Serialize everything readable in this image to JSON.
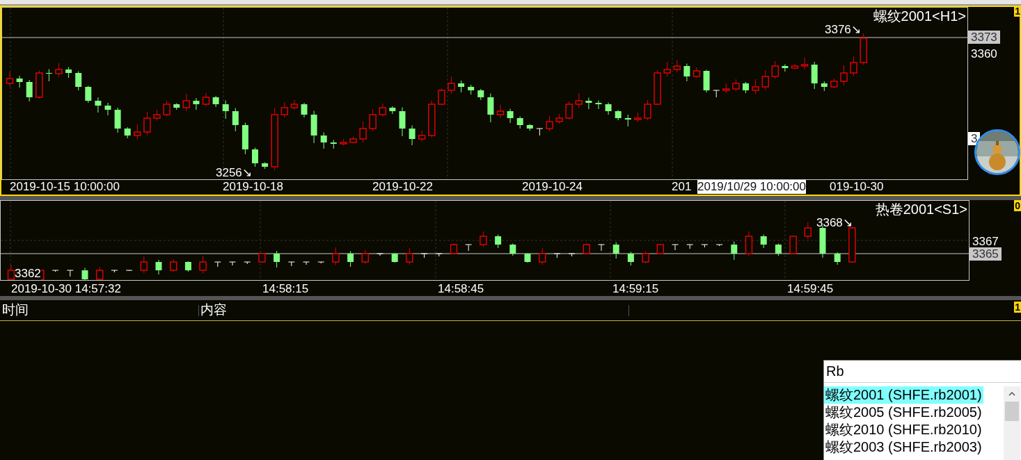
{
  "price_chart": {
    "title": "螺纹2001<H1>",
    "badge": "1",
    "high_label": "3376↘",
    "low_label": "3256↘",
    "axis_labels": [
      {
        "text": "3373",
        "kind": "current"
      },
      {
        "text": "3360",
        "kind": "tick"
      },
      {
        "text": "3",
        "kind": "marker"
      }
    ],
    "date_labels": [
      "2019-10-15 10:00:00",
      "2019-10-18",
      "2019-10-22",
      "2019-10-24",
      "201",
      "019-10-30"
    ],
    "crosshair_label": "2019/10/29 10:00:00"
  },
  "spread_chart": {
    "title": "热卷2001<S1>",
    "badge": "0",
    "high_label": "3368↘",
    "low_label": "3362",
    "axis_labels": [
      {
        "text": "3367",
        "kind": "tick"
      },
      {
        "text": "3365",
        "kind": "current"
      }
    ],
    "time_labels": [
      "2019-10-30 14:57:32",
      "14:58:15",
      "14:58:45",
      "14:59:15",
      "14:59:45"
    ]
  },
  "log": {
    "columns": [
      "时间",
      "内容"
    ],
    "badge": "1"
  },
  "symbol_search": {
    "value": "Rb",
    "items": [
      {
        "label": "螺纹2001 (SHFE.rb2001)",
        "selected": true
      },
      {
        "label": "螺纹2005 (SHFE.rb2005)",
        "selected": false
      },
      {
        "label": "螺纹2010 (SHFE.rb2010)",
        "selected": false
      },
      {
        "label": "螺纹2003 (SHFE.rb2003)",
        "selected": false
      }
    ]
  }
}
